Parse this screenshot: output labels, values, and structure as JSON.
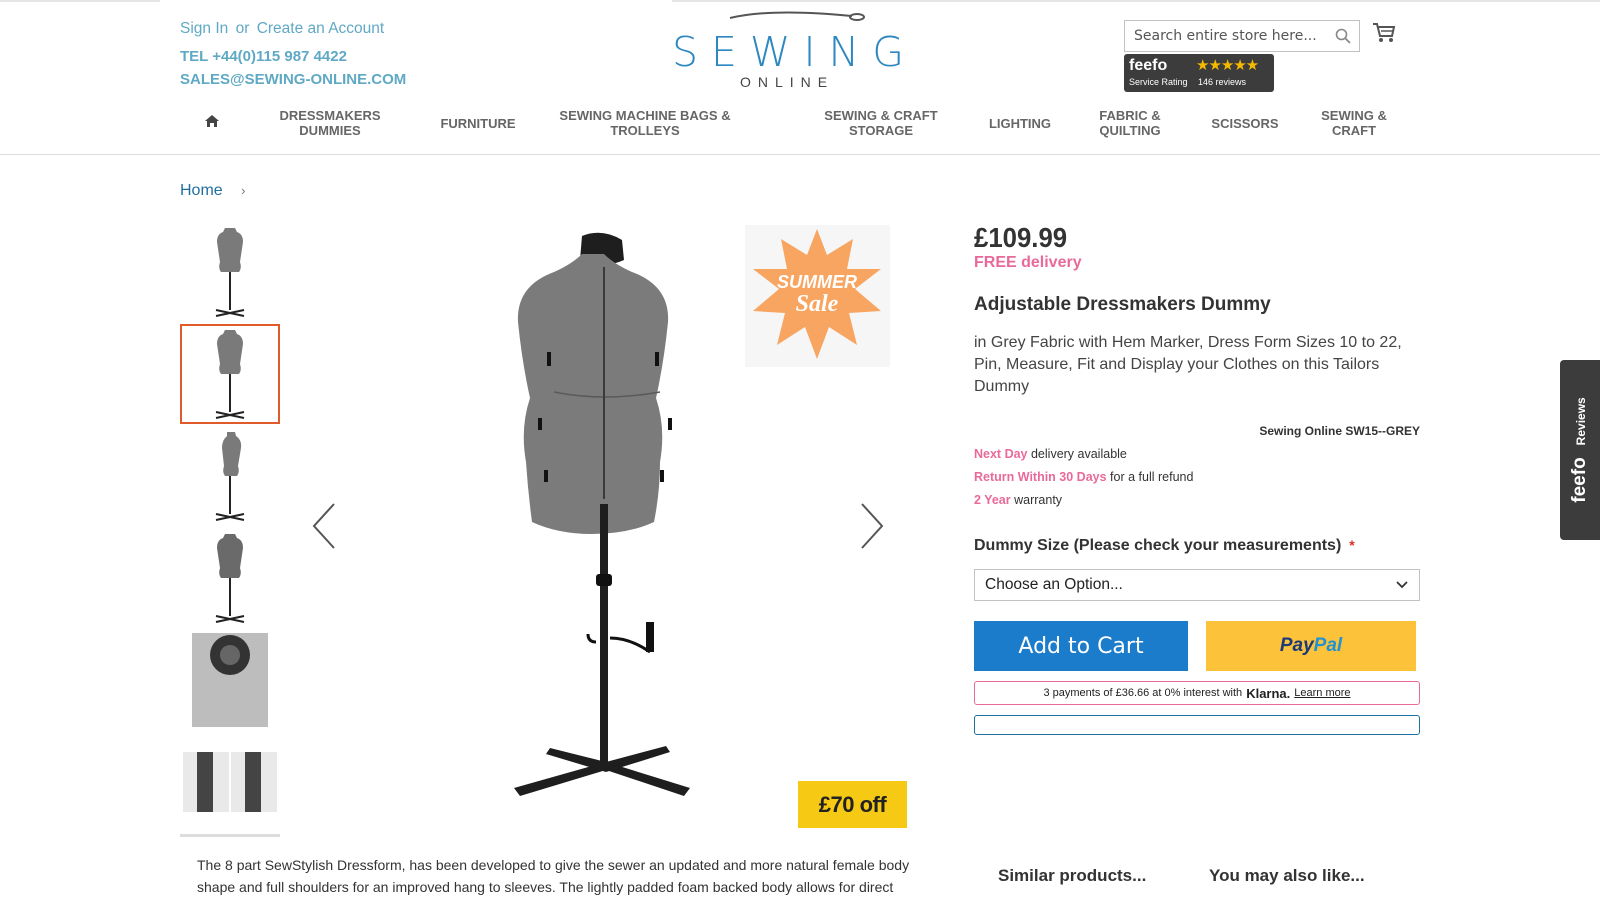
{
  "header": {
    "sign_in": "Sign In",
    "or": "or",
    "create_account": "Create an Account",
    "tel": "TEL +44(0)115 987 4422",
    "email": "SALES@SEWING-ONLINE.COM",
    "logo_word": "SEWING",
    "logo_sub": "ONLINE",
    "search_placeholder": "Search entire store here...",
    "feefo": {
      "brand": "feefo",
      "stars": "★★★★★",
      "label": "Service Rating",
      "reviews": "146 reviews"
    }
  },
  "nav": {
    "items": [
      "DRESSMAKERS DUMMIES",
      "FURNITURE",
      "SEWING MACHINE BAGS & TROLLEYS",
      "SEWING & CRAFT STORAGE",
      "LIGHTING",
      "FABRIC & QUILTING",
      "SCISSORS",
      "SEWING & CRAFT"
    ]
  },
  "breadcrumb": {
    "home": "Home",
    "separator": "›"
  },
  "badges": {
    "sale_top": "SUMMER",
    "sale_bottom": "Sale",
    "off": "£70 off"
  },
  "product": {
    "price": "£109.99",
    "free_delivery": "FREE delivery",
    "name": "Adjustable Dressmakers Dummy",
    "description": "in Grey Fabric with Hem Marker, Dress Form Sizes 10 to 22, Pin, Measure, Fit and Display your Clothes on this Tailors Dummy",
    "sku": "Sewing Online SW15--GREY",
    "perks": [
      {
        "highlight": "Next Day",
        "rest": "delivery available"
      },
      {
        "highlight": "Return Within 30 Days",
        "rest": "for a full refund"
      },
      {
        "highlight": "2 Year",
        "rest": "warranty"
      }
    ],
    "option_label": "Dummy Size (Please check your measurements)",
    "required_mark": "*",
    "option_value": "Choose an Option...",
    "add_to_cart": "Add to Cart",
    "paypal_p1": "Pay",
    "paypal_p2": "Pal",
    "klarna_text": "3 payments of £36.66 at 0% interest with",
    "klarna_brand": "Klarna.",
    "klarna_link": "Learn more"
  },
  "body": {
    "description": "The 8 part SewStylish Dressform, has been developed to give the sewer an updated and more natural female body shape and full shoulders for an improved hang to sleeves. The lightly padded foam backed body allows for direct",
    "similar": "Similar products...",
    "also_like": "You may also like..."
  },
  "reviews_tab": {
    "brand": "feefo",
    "label": "Reviews"
  },
  "colors": {
    "accent_blue": "#1b7ccc",
    "link_blue": "#5fa9c4",
    "pink": "#e96a9a",
    "paypal_yellow": "#fcc23a"
  }
}
